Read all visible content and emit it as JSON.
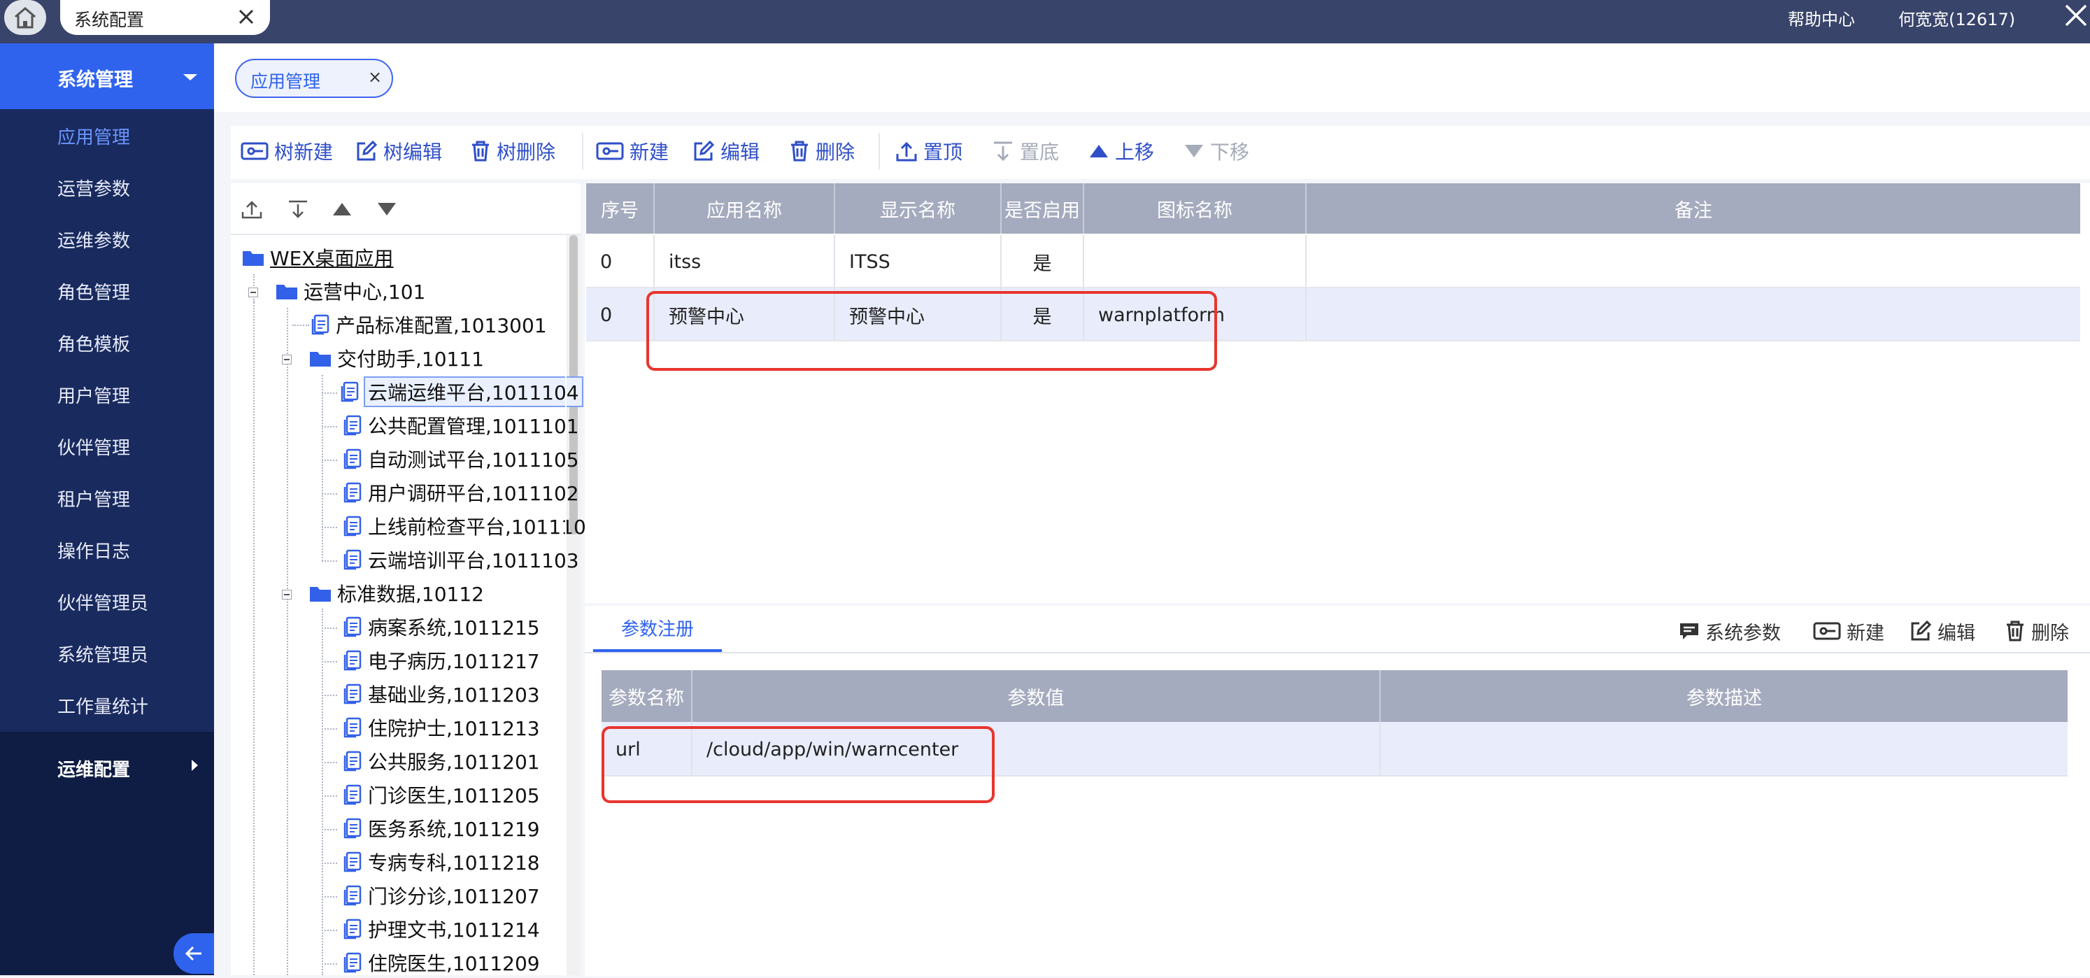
{
  "topbar": {
    "tab_label": "系统配置",
    "help_label": "帮助中心",
    "user_label": "何宽宽(12617)"
  },
  "sidebar": {
    "header": "系统管理",
    "items": [
      {
        "label": "应用管理",
        "active": true
      },
      {
        "label": "运营参数"
      },
      {
        "label": "运维参数"
      },
      {
        "label": "角色管理"
      },
      {
        "label": "角色模板"
      },
      {
        "label": "用户管理"
      },
      {
        "label": "伙伴管理"
      },
      {
        "label": "租户管理"
      },
      {
        "label": "操作日志"
      },
      {
        "label": "伙伴管理员"
      },
      {
        "label": "系统管理员"
      },
      {
        "label": "工作量统计"
      }
    ],
    "group2": "运维配置"
  },
  "page_tab": {
    "label": "应用管理",
    "close": "×"
  },
  "toolbar": {
    "tree_new": "树新建",
    "tree_edit": "树编辑",
    "tree_delete": "树删除",
    "new": "新建",
    "edit": "编辑",
    "delete": "删除",
    "top": "置顶",
    "bottom": "置底",
    "up": "上移",
    "down": "下移"
  },
  "tree": {
    "root": "WEX桌面应用",
    "nodes": [
      {
        "label": "运营中心,101",
        "type": "folder"
      },
      {
        "label": "产品标准配置,1013001",
        "type": "doc"
      },
      {
        "label": "交付助手,10111",
        "type": "folder"
      },
      {
        "label": "云端运维平台,1011104",
        "type": "doc",
        "selected": true
      },
      {
        "label": "公共配置管理,1011101",
        "type": "doc"
      },
      {
        "label": "自动测试平台,1011105",
        "type": "doc"
      },
      {
        "label": "用户调研平台,1011102",
        "type": "doc"
      },
      {
        "label": "上线前检查平台,101110",
        "type": "doc"
      },
      {
        "label": "云端培训平台,1011103",
        "type": "doc"
      },
      {
        "label": "标准数据,10112",
        "type": "folder"
      },
      {
        "label": "病案系统,1011215",
        "type": "doc"
      },
      {
        "label": "电子病历,1011217",
        "type": "doc"
      },
      {
        "label": "基础业务,1011203",
        "type": "doc"
      },
      {
        "label": "住院护士,1011213",
        "type": "doc"
      },
      {
        "label": "公共服务,1011201",
        "type": "doc"
      },
      {
        "label": "门诊医生,1011205",
        "type": "doc"
      },
      {
        "label": "医务系统,1011219",
        "type": "doc"
      },
      {
        "label": "专病专科,1011218",
        "type": "doc"
      },
      {
        "label": "门诊分诊,1011207",
        "type": "doc"
      },
      {
        "label": "护理文书,1011214",
        "type": "doc"
      },
      {
        "label": "住院医生,1011209",
        "type": "doc"
      }
    ]
  },
  "grid": {
    "headers": [
      "序号",
      "应用名称",
      "显示名称",
      "是否启用",
      "图标名称",
      "备注"
    ],
    "rows": [
      {
        "seq": "0",
        "app": "itss",
        "display": "ITSS",
        "enabled": "是",
        "icon": "",
        "note": ""
      },
      {
        "seq": "0",
        "app": "预警中心",
        "display": "预警中心",
        "enabled": "是",
        "icon": "warnplatform",
        "note": ""
      }
    ]
  },
  "params": {
    "tab": "参数注册",
    "sys_params": "系统参数",
    "new": "新建",
    "edit": "编辑",
    "delete": "删除",
    "headers": [
      "参数名称",
      "参数值",
      "参数描述"
    ],
    "rows": [
      {
        "name": "url",
        "value": "/cloud/app/win/warncenter",
        "desc": ""
      }
    ]
  },
  "colors": {
    "accent": "#2f63ee",
    "sidebar": "#192a5e",
    "topbar": "#38446a",
    "highlight": "#e8352e"
  }
}
